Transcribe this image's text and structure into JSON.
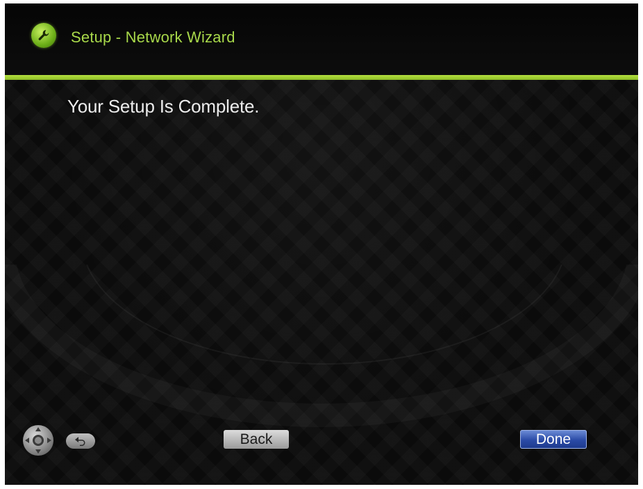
{
  "header": {
    "title": "Setup - Network Wizard",
    "icon": "wrench-icon",
    "accent_color": "#a8d84a"
  },
  "main": {
    "message": "Your Setup Is Complete."
  },
  "footer": {
    "remote_icon": "remote-dpad-icon",
    "return_icon": "return-arrow-icon",
    "back_label": "Back",
    "done_label": "Done"
  }
}
